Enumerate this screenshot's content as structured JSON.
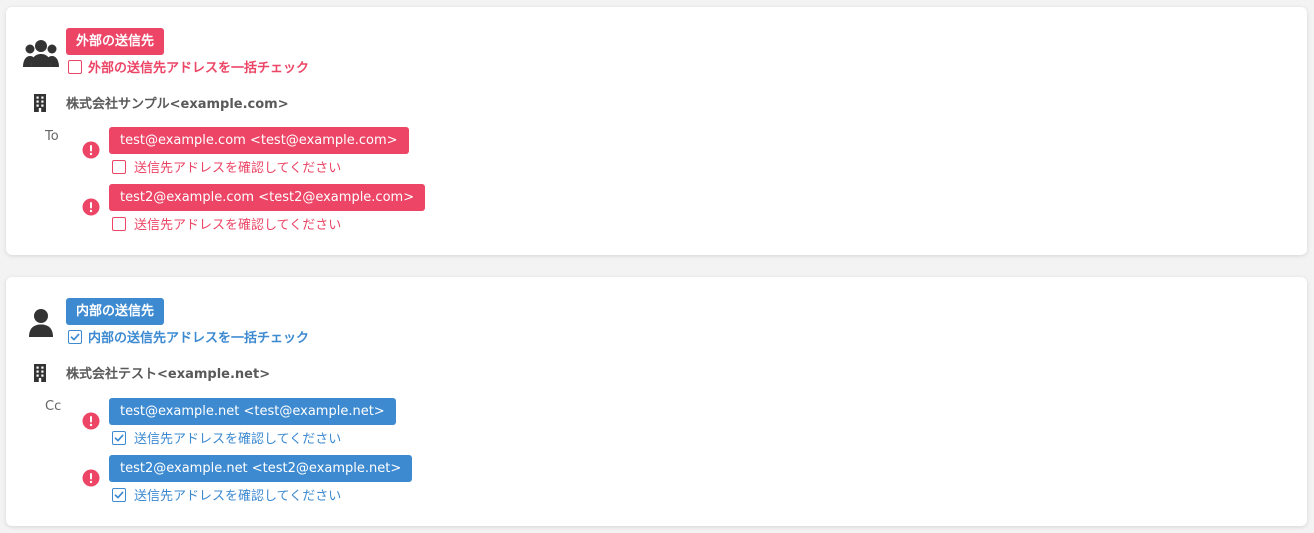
{
  "colors": {
    "external_accent": "#ec4566",
    "internal_accent": "#3d8ad1",
    "alert": "#ec4566",
    "icon": "#333333"
  },
  "external": {
    "group_icon": "users-icon",
    "tag": "外部の送信先",
    "check_all_label": "外部の送信先アドレスを一括チェック",
    "check_all_checked": false,
    "company": "株式会社サンプル<example.com>",
    "kind": "To",
    "recipients": [
      {
        "email": "test@example.com <test@example.com>",
        "confirm_label": "送信先アドレスを確認してください",
        "checked": false
      },
      {
        "email": "test2@example.com <test2@example.com>",
        "confirm_label": "送信先アドレスを確認してください",
        "checked": false
      }
    ]
  },
  "internal": {
    "group_icon": "user-icon",
    "tag": "内部の送信先",
    "check_all_label": "内部の送信先アドレスを一括チェック",
    "check_all_checked": true,
    "company": "株式会社テスト<example.net>",
    "kind": "Cc",
    "recipients": [
      {
        "email": "test@example.net <test@example.net>",
        "confirm_label": "送信先アドレスを確認してください",
        "checked": true
      },
      {
        "email": "test2@example.net <test2@example.net>",
        "confirm_label": "送信先アドレスを確認してください",
        "checked": true
      }
    ]
  }
}
